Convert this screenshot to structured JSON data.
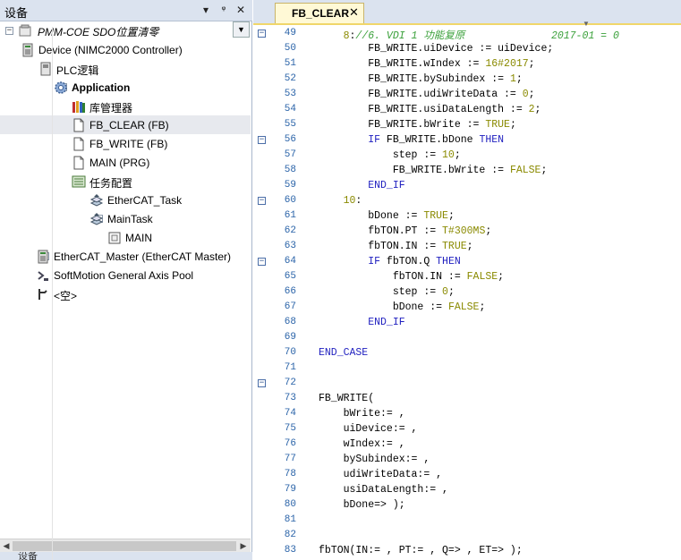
{
  "device_panel": {
    "title": "设备",
    "controls": {
      "dropdown": "▾",
      "pin": "ᵠ",
      "close": "✕"
    },
    "project": {
      "name": "PMM-COE SDO位置清零",
      "dropdown": "▼"
    },
    "tree": [
      {
        "label": "Device (NIMC2000 Controller)",
        "expander": "−",
        "icon": "device-icon"
      },
      {
        "label": "PLC逻辑",
        "expander": "−",
        "icon": "plc-logic-icon"
      },
      {
        "label": "Application",
        "expander": "−",
        "icon": "application-gear-icon"
      },
      {
        "label": "库管理器",
        "icon": "library-manager-icon"
      },
      {
        "label": "FB_CLEAR (FB)",
        "icon": "function-block-icon"
      },
      {
        "label": "FB_WRITE (FB)",
        "icon": "function-block-icon"
      },
      {
        "label": "MAIN (PRG)",
        "icon": "program-icon"
      },
      {
        "label": "任务配置",
        "expander": "−",
        "icon": "task-configuration-icon"
      },
      {
        "label": "EtherCAT_Task",
        "icon": "task-icon"
      },
      {
        "label": "MainTask",
        "expander": "−",
        "icon": "task-icon"
      },
      {
        "label": "MAIN",
        "icon": "program-call-icon"
      },
      {
        "label": "EtherCAT_Master (EtherCAT Master)",
        "expander": "+",
        "icon": "ethercat-master-icon"
      },
      {
        "label": "SoftMotion General Axis Pool",
        "icon": "axis-pool-icon"
      },
      {
        "label": "<空>",
        "icon": "empty-slot-icon"
      }
    ],
    "bottom_tab": "设备"
  },
  "editor": {
    "tab": {
      "label": "FB_CLEAR",
      "close": "✕"
    },
    "lines": [
      {
        "n": "49",
        "fold": true,
        "code": "    8://6. VDI 1 功能复原              2017-01 = 0"
      },
      {
        "n": "50",
        "code": "        FB_WRITE.uiDevice := uiDevice;"
      },
      {
        "n": "51",
        "code": "        FB_WRITE.wIndex := 16#2017;"
      },
      {
        "n": "52",
        "code": "        FB_WRITE.bySubindex := 1;"
      },
      {
        "n": "53",
        "code": "        FB_WRITE.udiWriteData := 0;"
      },
      {
        "n": "54",
        "code": "        FB_WRITE.usiDataLength := 2;"
      },
      {
        "n": "55",
        "code": "        FB_WRITE.bWrite := TRUE;"
      },
      {
        "n": "56",
        "fold": true,
        "code": "        IF FB_WRITE.bDone THEN"
      },
      {
        "n": "57",
        "code": "            step := 10;"
      },
      {
        "n": "58",
        "code": "            FB_WRITE.bWrite := FALSE;"
      },
      {
        "n": "59",
        "code": "        END_IF"
      },
      {
        "n": "60",
        "fold": true,
        "code": "    10:"
      },
      {
        "n": "61",
        "code": "        bDone := TRUE;"
      },
      {
        "n": "62",
        "code": "        fbTON.PT := T#300MS;"
      },
      {
        "n": "63",
        "code": "        fbTON.IN := TRUE;"
      },
      {
        "n": "64",
        "fold": true,
        "code": "        IF fbTON.Q THEN"
      },
      {
        "n": "65",
        "code": "            fbTON.IN := FALSE;"
      },
      {
        "n": "66",
        "code": "            step := 0;"
      },
      {
        "n": "67",
        "code": "            bDone := FALSE;"
      },
      {
        "n": "68",
        "code": "        END_IF"
      },
      {
        "n": "69",
        "code": ""
      },
      {
        "n": "70",
        "code": "END_CASE"
      },
      {
        "n": "71",
        "code": ""
      },
      {
        "n": "72",
        "fold": true,
        "code": ""
      },
      {
        "n": "73",
        "code": "FB_WRITE("
      },
      {
        "n": "74",
        "code": "    bWrite:= ,"
      },
      {
        "n": "75",
        "code": "    uiDevice:= ,"
      },
      {
        "n": "76",
        "code": "    wIndex:= ,"
      },
      {
        "n": "77",
        "code": "    bySubindex:= ,"
      },
      {
        "n": "78",
        "code": "    udiWriteData:= ,"
      },
      {
        "n": "79",
        "code": "    usiDataLength:= ,"
      },
      {
        "n": "80",
        "code": "    bDone=> );"
      },
      {
        "n": "81",
        "code": ""
      },
      {
        "n": "82",
        "code": ""
      },
      {
        "n": "83",
        "code": "fbTON(IN:= , PT:= , Q=> , ET=> );"
      }
    ]
  }
}
